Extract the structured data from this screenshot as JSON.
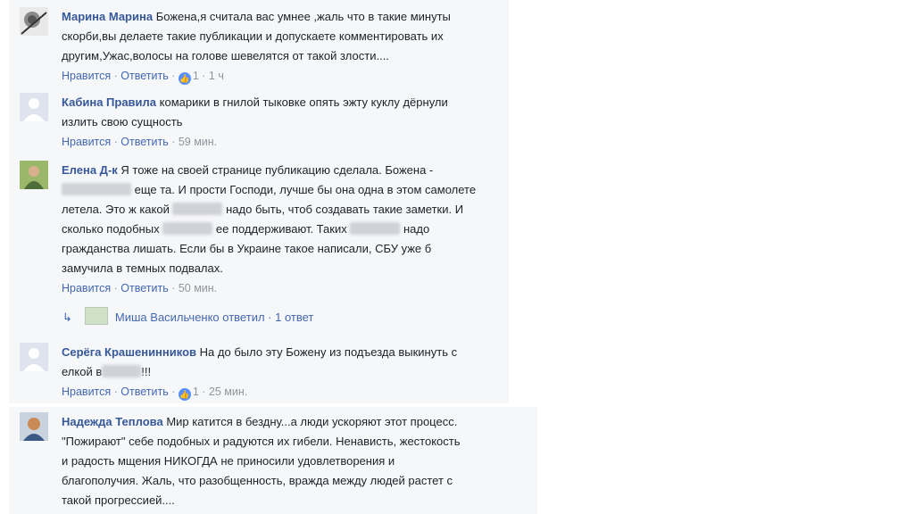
{
  "comments": [
    {
      "author": "Марина Марина",
      "lines": [
        "Божена,я считала вас умнее ,жаль что в такие минуты",
        "скорби,вы делаете такие публикации и допускаете комментировать их",
        "другим,Ужас,волосы на голове шевелятся от такой злости...."
      ],
      "like_label": "Нравится",
      "reply_label": "Ответить",
      "reactions": "1",
      "time": "1 ч"
    },
    {
      "author": "Кабина Правила",
      "lines": [
        "комарики в гнилой тыковке опять эжту куклу дёрнули",
        "излить свою сущность"
      ],
      "like_label": "Нравится",
      "reply_label": "Ответить",
      "time": "59 мин."
    },
    {
      "author": "Елена Д-к",
      "line1": "Я тоже на своей странице публикацию сделала. Божена -",
      "line2": "еще та. И прости Господи, лучше бы она одна в этом самолете",
      "line3a": "летела. Это ж какой",
      "line3b": "надо быть, чтоб создавать такие заметки. И",
      "line4a": "сколько подобных",
      "line4b": "ее поддерживают. Таких",
      "line4c": "надо",
      "line5": "гражданства лишать. Если бы в Украине такое написали, СБУ уже б",
      "line6": "замучила в темных подвалах.",
      "like_label": "Нравится",
      "reply_label": "Ответить",
      "time": "50 мин.",
      "replies": {
        "text": "Миша Васильченко ответил",
        "count": "1 ответ"
      }
    },
    {
      "author": "Серёга Крашенинников",
      "line1": "На до было эту Божену из подъезда выкинуть с",
      "line2a": "елкой в",
      "line2b": "!!!",
      "like_label": "Нравится",
      "reply_label": "Ответить",
      "reactions": "1",
      "time": "25 мин."
    },
    {
      "author": "Надежда Теплова",
      "lines": [
        "Мир катится в бездну...а люди ускоряют этот процесс.",
        "\"Пожирают\" себе подобных и радуются их гибели. Ненависть, жестокость",
        "и радость мщения НИКОГДА не приносили удовлетворения и",
        "благополучия. Жаль, что разобщенность, вражда между людей растет с",
        "такой прогрессией...."
      ]
    }
  ],
  "separators": {
    "dot": " · "
  },
  "icons": {
    "reaction": "like-icon",
    "reply": "reply-arrow-icon"
  }
}
